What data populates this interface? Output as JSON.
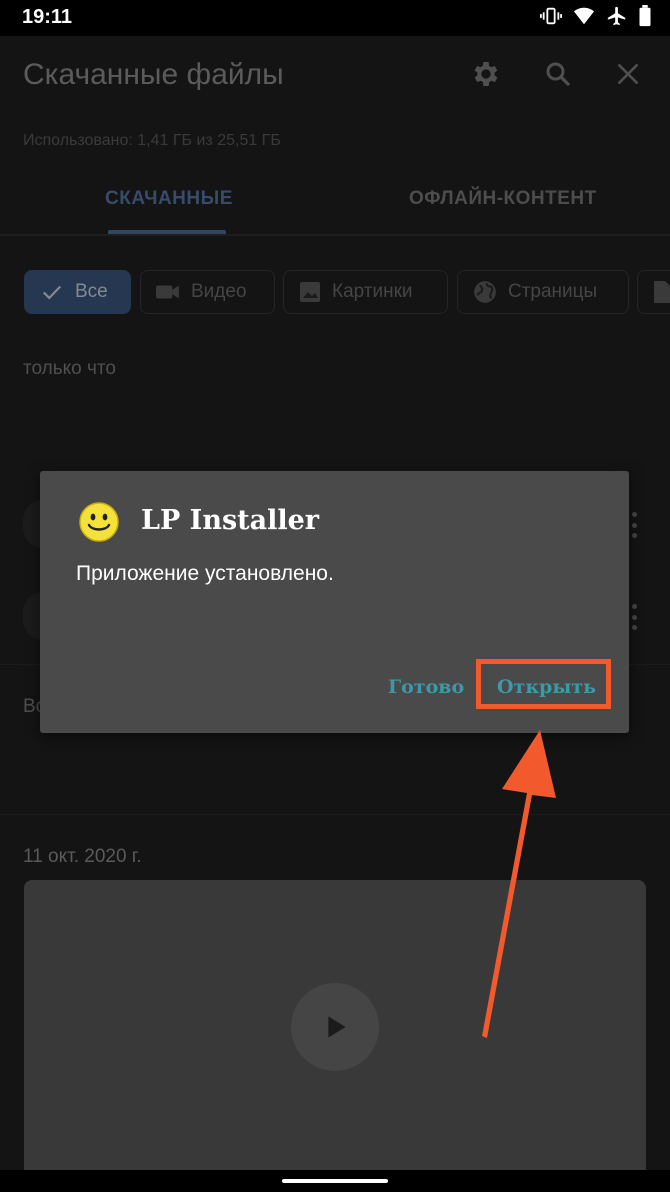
{
  "status_bar": {
    "time": "19:11"
  },
  "app_bar": {
    "title": "Скачанные файлы"
  },
  "usage_text": "Использовано: 1,41 ГБ из 25,51 ГБ",
  "tabs": [
    {
      "label": "СКАЧАННЫЕ"
    },
    {
      "label": "ОФЛАЙН-КОНТЕНТ"
    }
  ],
  "filters": [
    {
      "label": "Все"
    },
    {
      "label": "Видео"
    },
    {
      "label": "Картинки"
    },
    {
      "label": "Страницы"
    }
  ],
  "sections": {
    "recent": "только что",
    "partial_label": "Вс",
    "date": "11 окт. 2020 г."
  },
  "dialog": {
    "title": "LP  Installer",
    "message": "Приложение установлено.",
    "done_label": "Готово",
    "open_label": "Открыть"
  },
  "colors": {
    "accent_tab": "#5674a4",
    "dialog_button": "#3d98a8",
    "annotation": "#f25a2e"
  }
}
